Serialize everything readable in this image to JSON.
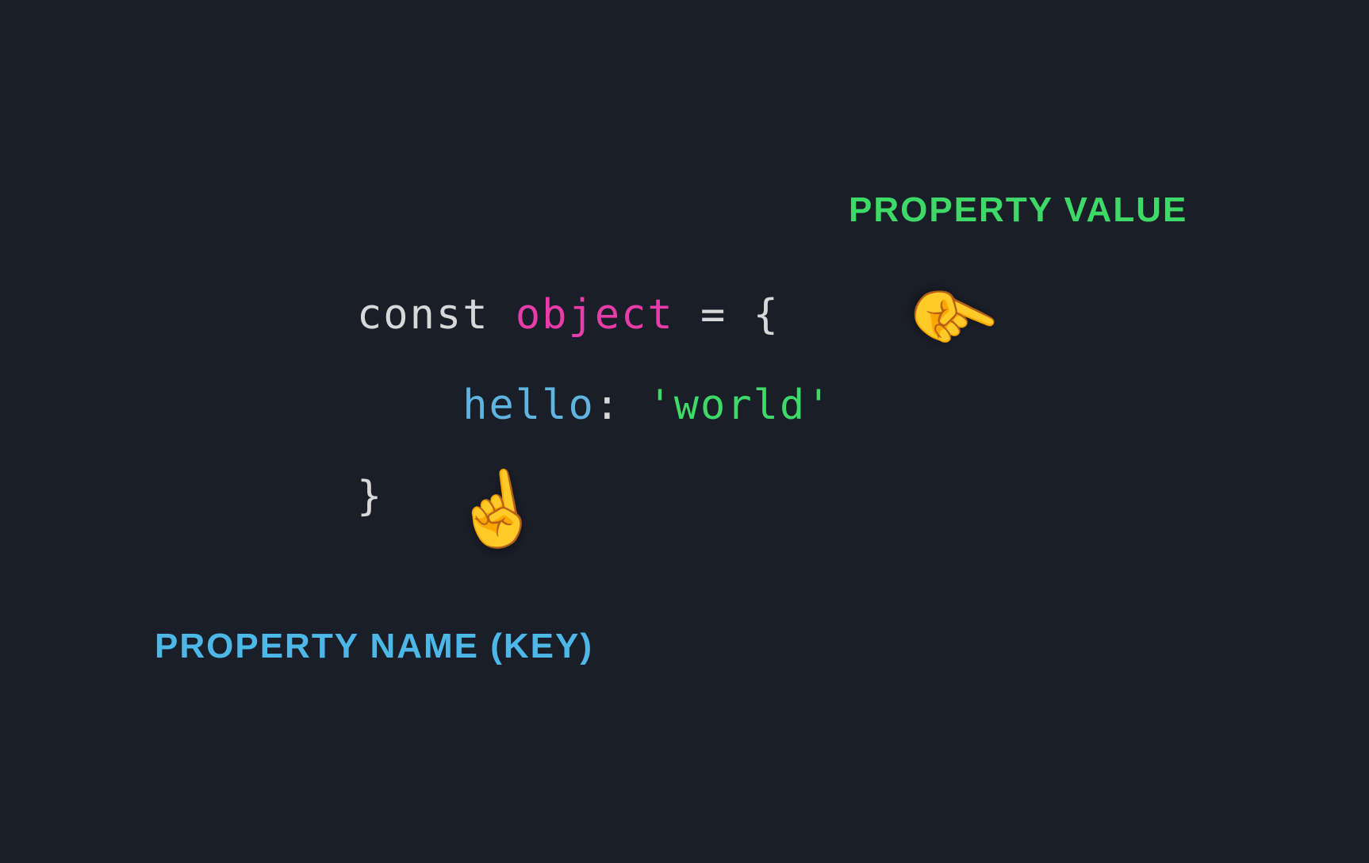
{
  "labels": {
    "propertyValue": "PROPERTY VALUE",
    "propertyKey": "PROPERTY NAME (KEY)"
  },
  "code": {
    "keyword": "const",
    "varname": "object",
    "equals": " = ",
    "openBrace": "{",
    "indent": "    ",
    "key": "hello",
    "colon": ": ",
    "string": "'world'",
    "closeBrace": "}"
  },
  "icons": {
    "pointerUp": "☝️",
    "pointerLeft": "☝️"
  }
}
